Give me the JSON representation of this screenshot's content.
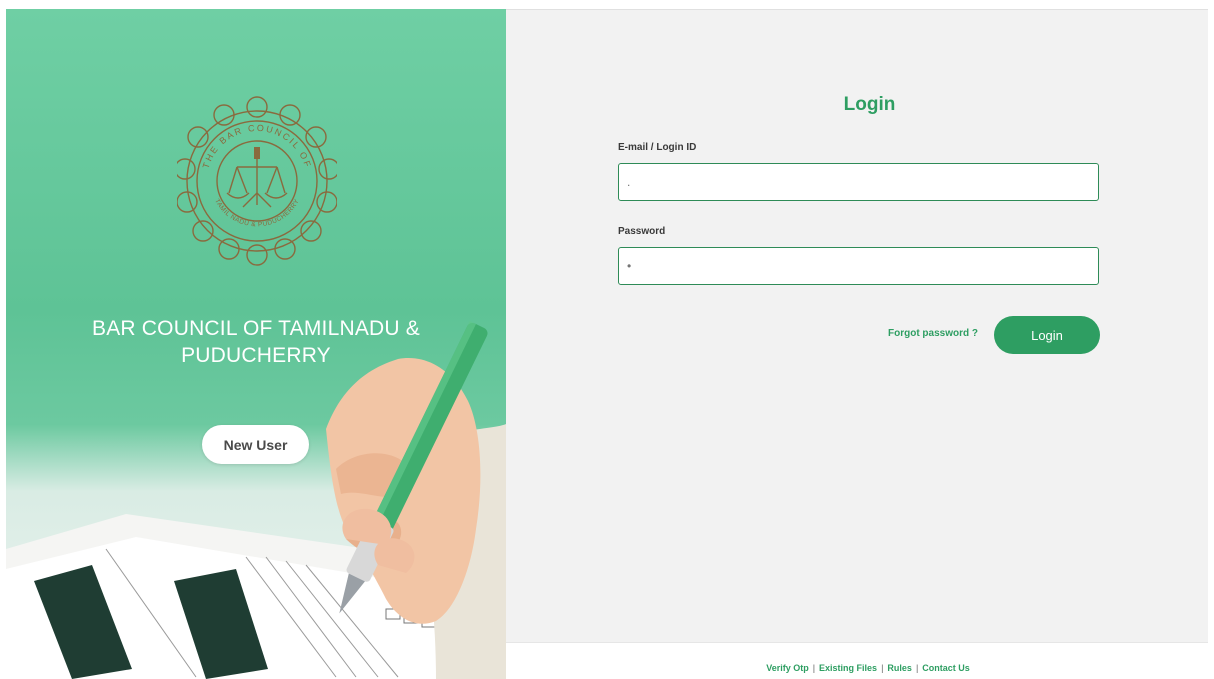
{
  "brand": {
    "org_name_line1": "BAR COUNCIL OF TAMILNADU &",
    "org_name_line2": "PUDUCHERRY",
    "seal_top_text": "THE BAR COUNCIL OF",
    "seal_bottom_text": "TAMIL NADU & PUDUCHERRY",
    "seal_color": "#8a6a3e"
  },
  "left_panel": {
    "new_user_label": "New User",
    "background_color": "#5ec396"
  },
  "login": {
    "title": "Login",
    "email_label": "E-mail / Login ID",
    "email_value": "",
    "email_placeholder": ".",
    "password_label": "Password",
    "password_value": "",
    "password_placeholder": "•",
    "forgot_label": "Forgot password ?",
    "submit_label": "Login",
    "accent_color": "#2e9e62"
  },
  "footer": {
    "links": [
      "Verify Otp",
      "Existing Files",
      "Rules",
      "Contact Us"
    ],
    "separator": "|"
  }
}
